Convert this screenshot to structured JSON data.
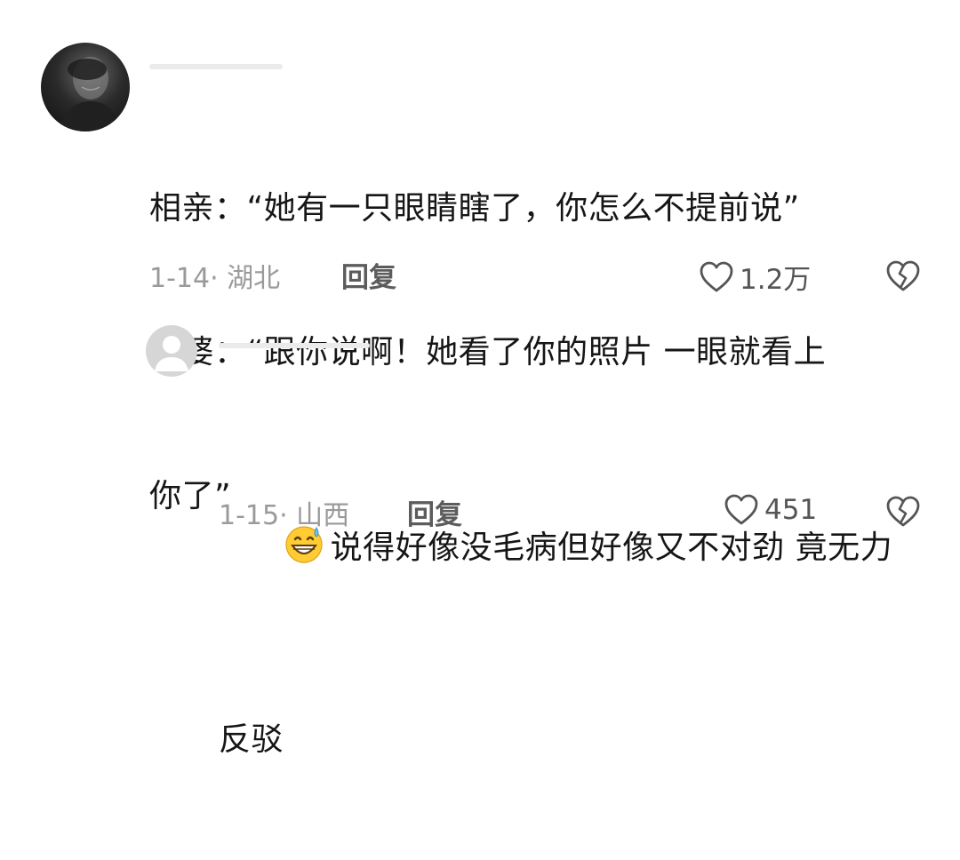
{
  "comments": [
    {
      "lines": [
        "相亲：“她有一只眼睛瞎了，你怎么不提前说”",
        "媒婆：“跟你说啊！她看了你的照片 一眼就看上",
        "你了”"
      ],
      "date": "1-14",
      "location": "湖北",
      "reply_label": "回复",
      "likes": "1.2万"
    },
    {
      "emoji": "grinning-sweat-emoji",
      "lines": [
        "说得好像没毛病但好像又不对劲 竟无力",
        "反驳"
      ],
      "date": "1-15",
      "location": "山西",
      "reply_label": "回复",
      "likes": "451"
    }
  ],
  "icons": {
    "like": "heart-outline-icon",
    "dislike": "broken-heart-icon"
  },
  "colors": {
    "meta_text": "#9a9a9a",
    "reply_label": "#5c5c5c",
    "body_text": "#161616"
  }
}
